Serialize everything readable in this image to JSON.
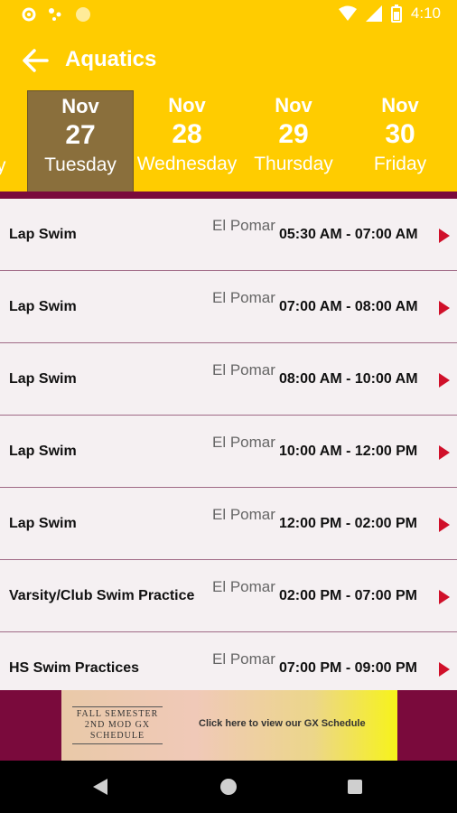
{
  "status_bar": {
    "time": "4:10"
  },
  "app_bar": {
    "title": "Aquatics"
  },
  "dates": [
    {
      "month": "Nov",
      "day": "27",
      "weekday": "Tuesday",
      "selected": true
    },
    {
      "month": "Nov",
      "day": "28",
      "weekday": "Wednesday",
      "selected": false
    },
    {
      "month": "Nov",
      "day": "29",
      "weekday": "Thursday",
      "selected": false
    },
    {
      "month": "Nov",
      "day": "30",
      "weekday": "Friday",
      "selected": false
    }
  ],
  "prev_date_partial": "y",
  "sessions": [
    {
      "name": "Lap Swim",
      "location": "El Pomar",
      "time": "05:30 AM - 07:00 AM"
    },
    {
      "name": "Lap Swim",
      "location": "El Pomar",
      "time": "07:00 AM - 08:00 AM"
    },
    {
      "name": "Lap Swim",
      "location": "El Pomar",
      "time": "08:00 AM - 10:00 AM"
    },
    {
      "name": "Lap Swim",
      "location": "El Pomar",
      "time": "10:00 AM - 12:00 PM"
    },
    {
      "name": "Lap Swim",
      "location": "El Pomar",
      "time": "12:00 PM - 02:00 PM"
    },
    {
      "name": "Varsity/Club Swim Practice",
      "location": "El Pomar",
      "time": "02:00 PM - 07:00 PM"
    },
    {
      "name": "HS Swim Practices",
      "location": "El Pomar",
      "time": "07:00 PM - 09:00 PM"
    }
  ],
  "banner": {
    "left_text": "FALL SEMESTER 2ND MOD GX SCHEDULE",
    "right_text": "Click here to view our GX Schedule"
  },
  "colors": {
    "primary": "#ffcc00",
    "selected": "#8a6f3c",
    "accent": "#7a0a3c",
    "arrow": "#d0102a"
  }
}
